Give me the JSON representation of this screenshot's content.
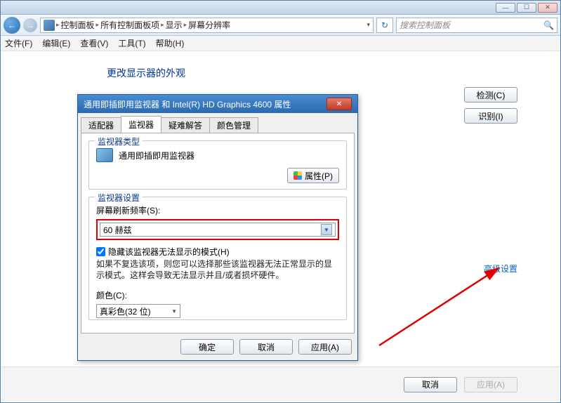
{
  "window": {
    "min": "—",
    "max": "☐",
    "close": "✕"
  },
  "breadcrumb": {
    "items": [
      "控制面板",
      "所有控制面板项",
      "显示",
      "屏幕分辨率"
    ]
  },
  "search": {
    "placeholder": "搜索控制面板"
  },
  "menu": {
    "file": "文件(F)",
    "edit": "编辑(E)",
    "view": "查看(V)",
    "tools": "工具(T)",
    "help": "帮助(H)"
  },
  "page": {
    "title": "更改显示器的外观",
    "detect": "检测(C)",
    "identify": "识别(I)",
    "advanced": "高级设置",
    "cancel": "取消",
    "apply": "应用(A)"
  },
  "dialog": {
    "title": "通用即插即用监视器 和 Intel(R) HD Graphics 4600 属性",
    "tabs": {
      "adapter": "适配器",
      "monitor": "监视器",
      "troubleshoot": "疑难解答",
      "color": "颜色管理"
    },
    "group_type": "监视器类型",
    "monitor_name": "通用即插即用监视器",
    "properties_btn": "属性(P)",
    "group_settings": "监视器设置",
    "refresh_label": "屏幕刷新频率(S):",
    "refresh_value": "60 赫兹",
    "hide_checkbox": "隐藏该监视器无法显示的模式(H)",
    "hide_desc": "如果不复选该项，则您可以选择那些该监视器无法正常显示的显示模式。这样会导致无法显示并且/或者损坏硬件。",
    "color_label": "颜色(C):",
    "color_value": "真彩色(32 位)",
    "ok": "确定",
    "cancel": "取消",
    "apply": "应用(A)"
  }
}
